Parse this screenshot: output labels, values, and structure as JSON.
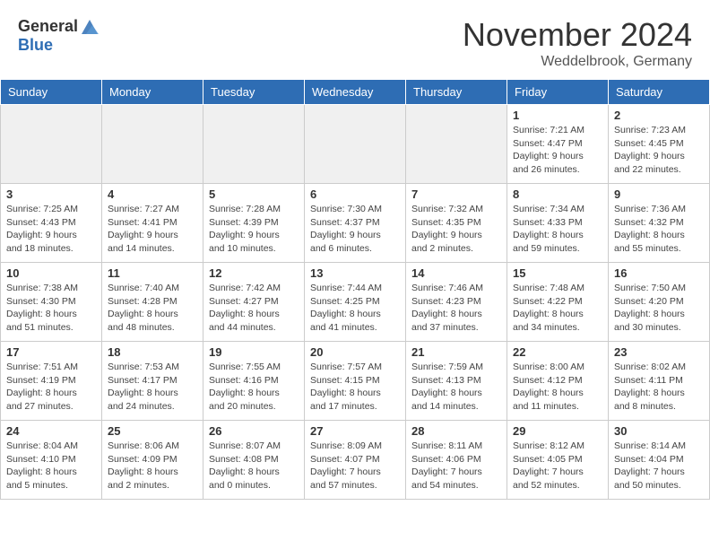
{
  "header": {
    "logo_general": "General",
    "logo_blue": "Blue",
    "month_title": "November 2024",
    "location": "Weddelbrook, Germany"
  },
  "columns": [
    "Sunday",
    "Monday",
    "Tuesday",
    "Wednesday",
    "Thursday",
    "Friday",
    "Saturday"
  ],
  "weeks": [
    [
      {
        "day": "",
        "info": "",
        "empty": true
      },
      {
        "day": "",
        "info": "",
        "empty": true
      },
      {
        "day": "",
        "info": "",
        "empty": true
      },
      {
        "day": "",
        "info": "",
        "empty": true
      },
      {
        "day": "",
        "info": "",
        "empty": true
      },
      {
        "day": "1",
        "info": "Sunrise: 7:21 AM\nSunset: 4:47 PM\nDaylight: 9 hours\nand 26 minutes."
      },
      {
        "day": "2",
        "info": "Sunrise: 7:23 AM\nSunset: 4:45 PM\nDaylight: 9 hours\nand 22 minutes."
      }
    ],
    [
      {
        "day": "3",
        "info": "Sunrise: 7:25 AM\nSunset: 4:43 PM\nDaylight: 9 hours\nand 18 minutes."
      },
      {
        "day": "4",
        "info": "Sunrise: 7:27 AM\nSunset: 4:41 PM\nDaylight: 9 hours\nand 14 minutes."
      },
      {
        "day": "5",
        "info": "Sunrise: 7:28 AM\nSunset: 4:39 PM\nDaylight: 9 hours\nand 10 minutes."
      },
      {
        "day": "6",
        "info": "Sunrise: 7:30 AM\nSunset: 4:37 PM\nDaylight: 9 hours\nand 6 minutes."
      },
      {
        "day": "7",
        "info": "Sunrise: 7:32 AM\nSunset: 4:35 PM\nDaylight: 9 hours\nand 2 minutes."
      },
      {
        "day": "8",
        "info": "Sunrise: 7:34 AM\nSunset: 4:33 PM\nDaylight: 8 hours\nand 59 minutes."
      },
      {
        "day": "9",
        "info": "Sunrise: 7:36 AM\nSunset: 4:32 PM\nDaylight: 8 hours\nand 55 minutes."
      }
    ],
    [
      {
        "day": "10",
        "info": "Sunrise: 7:38 AM\nSunset: 4:30 PM\nDaylight: 8 hours\nand 51 minutes."
      },
      {
        "day": "11",
        "info": "Sunrise: 7:40 AM\nSunset: 4:28 PM\nDaylight: 8 hours\nand 48 minutes."
      },
      {
        "day": "12",
        "info": "Sunrise: 7:42 AM\nSunset: 4:27 PM\nDaylight: 8 hours\nand 44 minutes."
      },
      {
        "day": "13",
        "info": "Sunrise: 7:44 AM\nSunset: 4:25 PM\nDaylight: 8 hours\nand 41 minutes."
      },
      {
        "day": "14",
        "info": "Sunrise: 7:46 AM\nSunset: 4:23 PM\nDaylight: 8 hours\nand 37 minutes."
      },
      {
        "day": "15",
        "info": "Sunrise: 7:48 AM\nSunset: 4:22 PM\nDaylight: 8 hours\nand 34 minutes."
      },
      {
        "day": "16",
        "info": "Sunrise: 7:50 AM\nSunset: 4:20 PM\nDaylight: 8 hours\nand 30 minutes."
      }
    ],
    [
      {
        "day": "17",
        "info": "Sunrise: 7:51 AM\nSunset: 4:19 PM\nDaylight: 8 hours\nand 27 minutes."
      },
      {
        "day": "18",
        "info": "Sunrise: 7:53 AM\nSunset: 4:17 PM\nDaylight: 8 hours\nand 24 minutes."
      },
      {
        "day": "19",
        "info": "Sunrise: 7:55 AM\nSunset: 4:16 PM\nDaylight: 8 hours\nand 20 minutes."
      },
      {
        "day": "20",
        "info": "Sunrise: 7:57 AM\nSunset: 4:15 PM\nDaylight: 8 hours\nand 17 minutes."
      },
      {
        "day": "21",
        "info": "Sunrise: 7:59 AM\nSunset: 4:13 PM\nDaylight: 8 hours\nand 14 minutes."
      },
      {
        "day": "22",
        "info": "Sunrise: 8:00 AM\nSunset: 4:12 PM\nDaylight: 8 hours\nand 11 minutes."
      },
      {
        "day": "23",
        "info": "Sunrise: 8:02 AM\nSunset: 4:11 PM\nDaylight: 8 hours\nand 8 minutes."
      }
    ],
    [
      {
        "day": "24",
        "info": "Sunrise: 8:04 AM\nSunset: 4:10 PM\nDaylight: 8 hours\nand 5 minutes."
      },
      {
        "day": "25",
        "info": "Sunrise: 8:06 AM\nSunset: 4:09 PM\nDaylight: 8 hours\nand 2 minutes."
      },
      {
        "day": "26",
        "info": "Sunrise: 8:07 AM\nSunset: 4:08 PM\nDaylight: 8 hours\nand 0 minutes."
      },
      {
        "day": "27",
        "info": "Sunrise: 8:09 AM\nSunset: 4:07 PM\nDaylight: 7 hours\nand 57 minutes."
      },
      {
        "day": "28",
        "info": "Sunrise: 8:11 AM\nSunset: 4:06 PM\nDaylight: 7 hours\nand 54 minutes."
      },
      {
        "day": "29",
        "info": "Sunrise: 8:12 AM\nSunset: 4:05 PM\nDaylight: 7 hours\nand 52 minutes."
      },
      {
        "day": "30",
        "info": "Sunrise: 8:14 AM\nSunset: 4:04 PM\nDaylight: 7 hours\nand 50 minutes."
      }
    ]
  ]
}
